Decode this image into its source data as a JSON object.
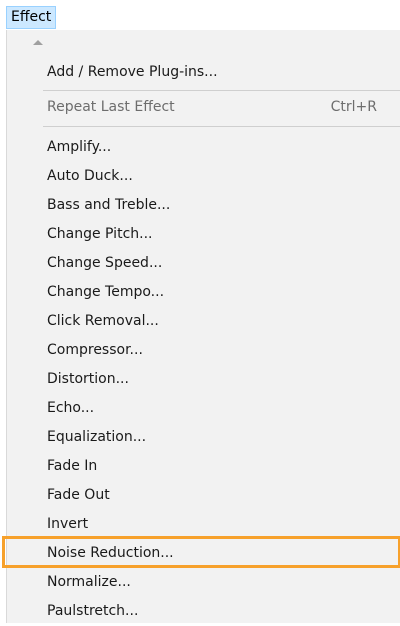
{
  "menubar": {
    "effect_label": "Effect"
  },
  "menu": {
    "top_items": [
      {
        "label": "Add / Remove Plug-ins..."
      }
    ],
    "repeat": {
      "label": "Repeat Last Effect",
      "shortcut": "Ctrl+R"
    },
    "effects": [
      {
        "label": "Amplify..."
      },
      {
        "label": "Auto Duck..."
      },
      {
        "label": "Bass and Treble..."
      },
      {
        "label": "Change Pitch..."
      },
      {
        "label": "Change Speed..."
      },
      {
        "label": "Change Tempo..."
      },
      {
        "label": "Click Removal..."
      },
      {
        "label": "Compressor..."
      },
      {
        "label": "Distortion..."
      },
      {
        "label": "Echo..."
      },
      {
        "label": "Equalization..."
      },
      {
        "label": "Fade In"
      },
      {
        "label": "Fade Out"
      },
      {
        "label": "Invert"
      },
      {
        "label": "Noise Reduction..."
      },
      {
        "label": "Normalize..."
      },
      {
        "label": "Paulstretch..."
      }
    ],
    "highlighted_item": "Noise Reduction...",
    "highlight_color": "#f7a12b"
  }
}
